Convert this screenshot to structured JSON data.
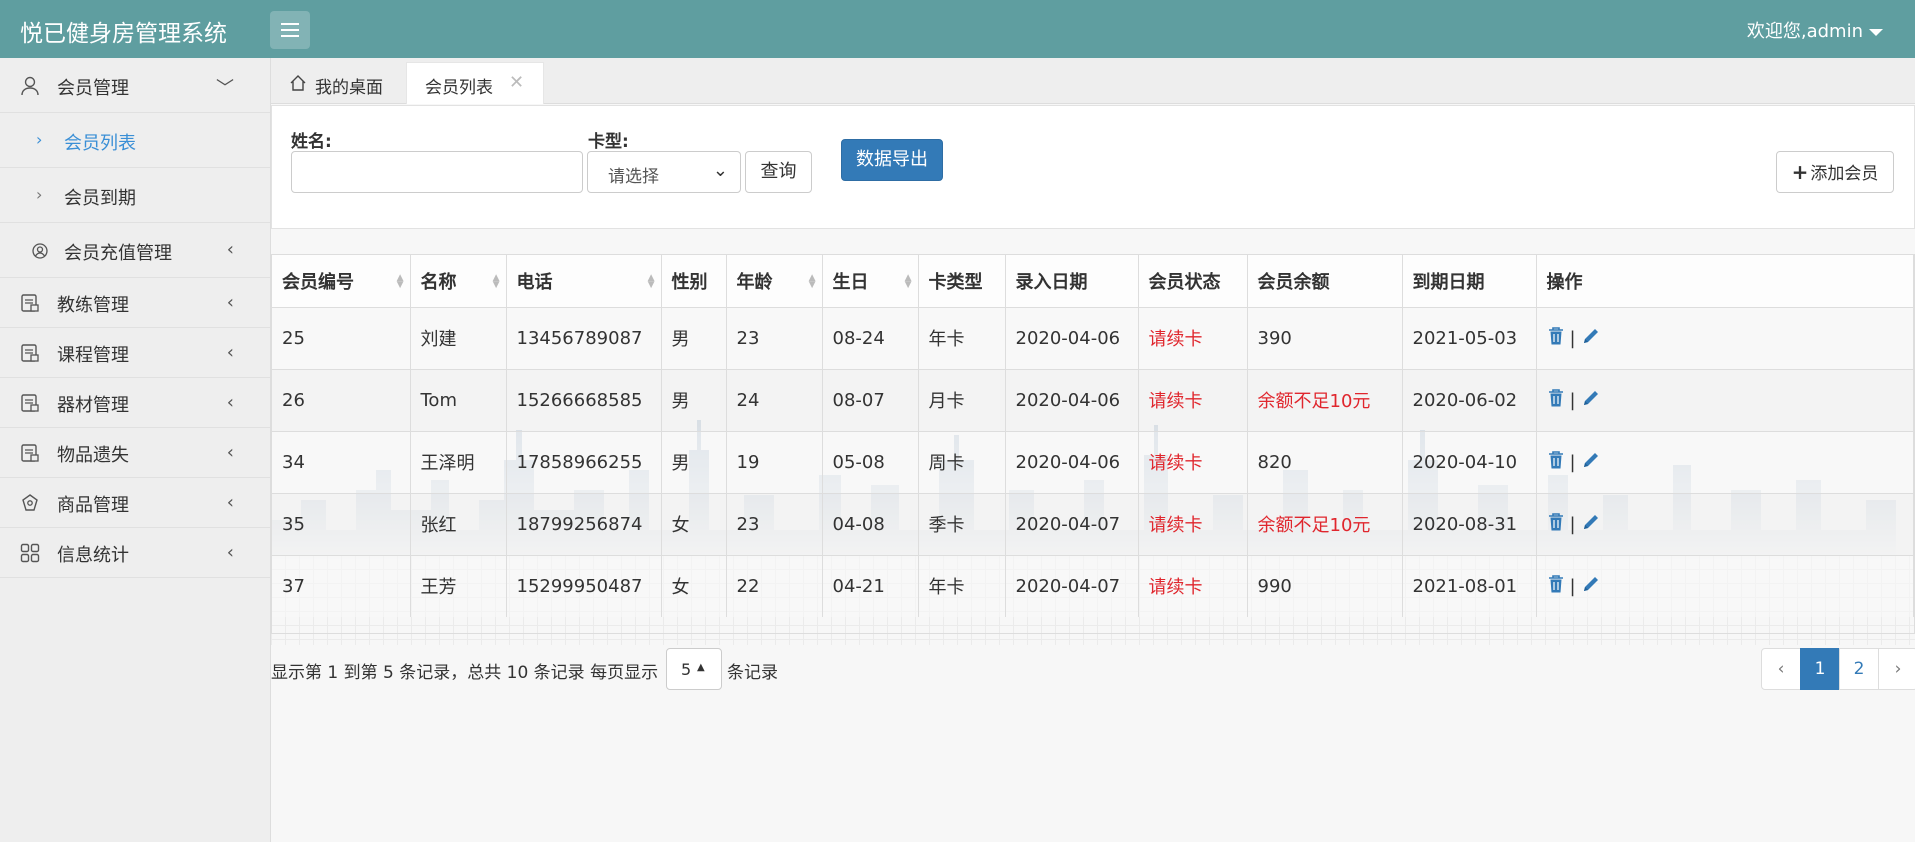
{
  "app": {
    "brand": "悦已健身房管理系统",
    "welcome": "欢迎您,admin"
  },
  "sidebar": {
    "member_group": "会员管理",
    "member_list": "会员列表",
    "member_expire": "会员到期",
    "member_recharge": "会员充值管理",
    "coach": "教练管理",
    "course": "课程管理",
    "equipment": "器材管理",
    "lost_items": "物品遗失",
    "goods": "商品管理",
    "stats": "信息统计"
  },
  "tabs": {
    "desktop": "我的桌面",
    "member_list": "会员列表"
  },
  "filter": {
    "name_label": "姓名:",
    "name_value": "",
    "card_label": "卡型:",
    "card_selected": "请选择",
    "query_button": "查询",
    "export_button": "数据导出",
    "add_button": "添加会员"
  },
  "table": {
    "columns": [
      "会员编号",
      "名称",
      "电话",
      "性别",
      "年龄",
      "生日",
      "卡类型",
      "录入日期",
      "会员状态",
      "会员余额",
      "到期日期",
      "操作"
    ],
    "rows": [
      [
        "25",
        "刘建",
        "13456789087",
        "男",
        "23",
        "08-24",
        "年卡",
        "2020-04-06",
        "请续卡",
        "390",
        "2021-05-03"
      ],
      [
        "26",
        "Tom",
        "15266668585",
        "男",
        "24",
        "08-07",
        "月卡",
        "2020-04-06",
        "请续卡",
        "余额不足10元",
        "2020-06-02"
      ],
      [
        "34",
        "王泽明",
        "17858966255",
        "男",
        "19",
        "05-08",
        "周卡",
        "2020-04-06",
        "请续卡",
        "820",
        "2020-04-10"
      ],
      [
        "35",
        "张红",
        "18799256874",
        "女",
        "23",
        "04-08",
        "季卡",
        "2020-04-07",
        "请续卡",
        "余额不足10元",
        "2020-08-31"
      ],
      [
        "37",
        "王芳",
        "15299950487",
        "女",
        "22",
        "04-21",
        "年卡",
        "2020-04-07",
        "请续卡",
        "990",
        "2021-08-01"
      ]
    ],
    "op_separator": "|"
  },
  "pagination": {
    "info": "显示第 1 到第 5 条记录，总共 10 条记录 每页显示",
    "page_size": "5",
    "suffix": "条记录",
    "prev": "‹",
    "pages": [
      "1",
      "2"
    ],
    "next": "›",
    "current": "1"
  },
  "colors": {
    "header": "#5f9ea0",
    "primary": "#337ab7",
    "alert": "#e0262d",
    "active_link": "#3a8fd6"
  }
}
